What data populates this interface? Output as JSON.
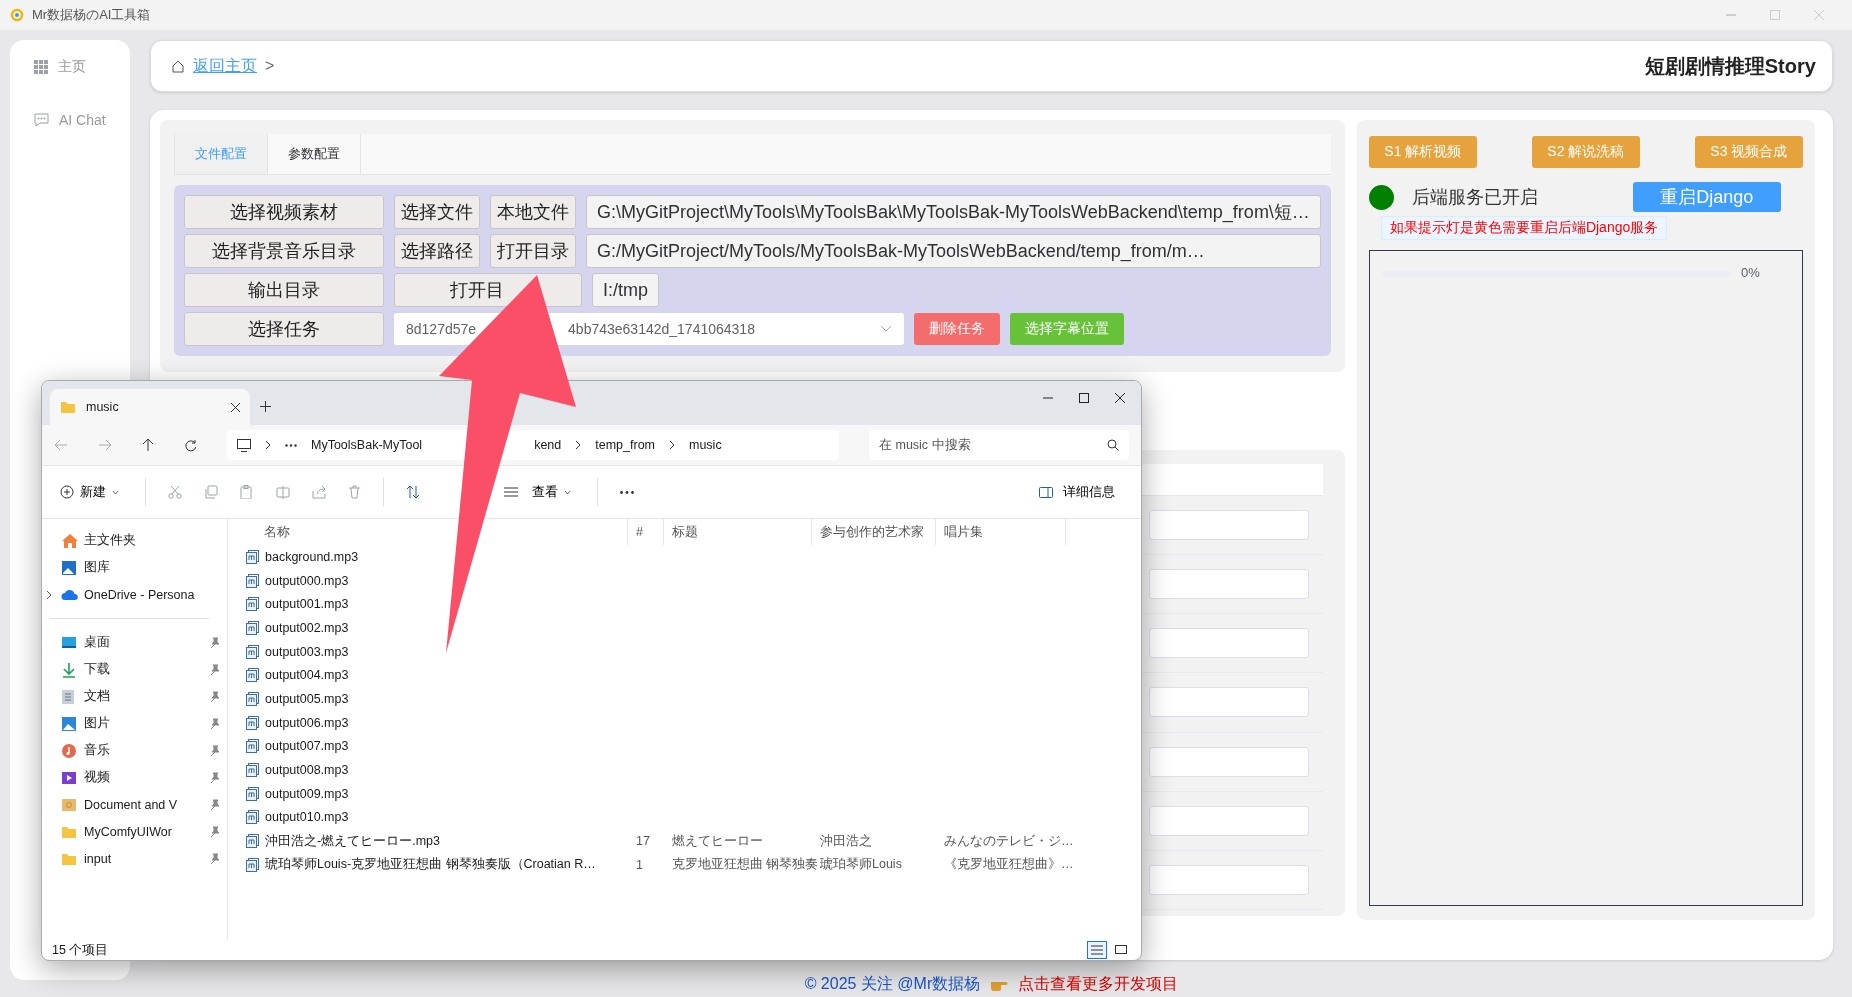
{
  "window": {
    "title": "Mr数据杨のAI工具箱"
  },
  "sidebar": {
    "items": [
      {
        "label": "主页",
        "kind": "grid"
      },
      {
        "label": "AI Chat",
        "kind": "chat"
      }
    ]
  },
  "header": {
    "breadcrumb_link": "返回主页",
    "breadcrumb_separator": ">",
    "title": "短剧剧情推理Story"
  },
  "config_tabs": [
    {
      "label": "文件配置",
      "selected": true
    },
    {
      "label": "参数配置",
      "selected": false
    }
  ],
  "file_rows": [
    {
      "label": "选择视频素材",
      "actions": [
        "选择文件",
        "本地文件"
      ],
      "path": "G:\\MyGitProject\\MyTools\\MyToolsBak\\MyToolsBak-MyToolsWebBackend\\temp_from\\短…"
    },
    {
      "label": "选择背景音乐目录",
      "actions": [
        "选择路径",
        "打开目录"
      ],
      "path": "G:/MyGitProject/MyTools/MyToolsBak-MyToolsWebBackend/temp_from/m…"
    },
    {
      "label": "输出目录",
      "actions": [
        "打开目"
      ],
      "path": "I:/tmp"
    }
  ],
  "task_row": {
    "label": "选择任务",
    "select_parts": [
      "8d127d57e",
      "4bb743e63142d_1741064318"
    ],
    "delete": "删除任务",
    "subtitle": "选择字幕位置"
  },
  "param_fields": [
    {
      "kind": "input"
    },
    {
      "kind": "input"
    },
    {
      "kind": "input"
    },
    {
      "kind": "input"
    },
    {
      "kind": "input"
    },
    {
      "kind": "input"
    },
    {
      "kind": "input"
    }
  ],
  "steps": [
    "S1 解析视频",
    "S2 解说洗稿",
    "S3 视频合成"
  ],
  "service": {
    "online": true,
    "label": "后端服务已开启",
    "restart": "重启Django",
    "note": "如果提示灯是黄色需要重启后端Django服务"
  },
  "progress": {
    "level": 0,
    "reading": "0%"
  },
  "footer": {
    "copyright": "© 2025 关注 @Mr数据杨",
    "link": "点击查看更多开发项目"
  },
  "explorer": {
    "tab_title": "music",
    "path_segments": [
      {
        "parts": [
          "MyToolsBak-MyTool",
          "kend"
        ]
      },
      {
        "parts": [
          "temp_from"
        ]
      },
      {
        "parts": [
          "music"
        ]
      }
    ],
    "search_placeholder": "在 music 中搜索",
    "new_label": "新建",
    "view_label": "查看",
    "details_label": "详细信息",
    "nav_groups": [
      [
        {
          "label": "主文件夹",
          "kind": "home",
          "pinned": false,
          "expandable": false
        },
        {
          "label": "图库",
          "kind": "gallery",
          "pinned": false,
          "expandable": false
        },
        {
          "label": "OneDrive - Persona",
          "kind": "cloud",
          "pinned": false,
          "expandable": true
        }
      ],
      [
        {
          "label": "桌面",
          "kind": "desktop",
          "pinned": true,
          "expandable": false
        },
        {
          "label": "下载",
          "kind": "download",
          "pinned": true,
          "expandable": false
        },
        {
          "label": "文档",
          "kind": "document",
          "pinned": true,
          "expandable": false
        },
        {
          "label": "图片",
          "kind": "pictures",
          "pinned": true,
          "expandable": false
        },
        {
          "label": "音乐",
          "kind": "music",
          "pinned": true,
          "expandable": false
        },
        {
          "label": "视频",
          "kind": "video",
          "pinned": true,
          "expandable": false
        },
        {
          "label": "Document and V",
          "kind": "shared",
          "pinned": true,
          "expandable": false
        },
        {
          "label": "MyComfyUIWor",
          "kind": "folder",
          "pinned": true,
          "expandable": false
        },
        {
          "label": "input",
          "kind": "folder",
          "pinned": true,
          "expandable": false
        }
      ]
    ],
    "columns": [
      "名称",
      "#",
      "标题",
      "参与创作的艺术家",
      "唱片集"
    ],
    "files": [
      {
        "name": "background.mp3"
      },
      {
        "name": "output000.mp3"
      },
      {
        "name": "output001.mp3"
      },
      {
        "name": "output002.mp3"
      },
      {
        "name": "output003.mp3"
      },
      {
        "name": "output004.mp3"
      },
      {
        "name": "output005.mp3"
      },
      {
        "name": "output006.mp3"
      },
      {
        "name": "output007.mp3"
      },
      {
        "name": "output008.mp3"
      },
      {
        "name": "output009.mp3"
      },
      {
        "name": "output010.mp3"
      },
      {
        "name": "沖田浩之-燃えてヒーロー.mp3",
        "number": "17",
        "title": "燃えてヒーロー",
        "artist": "沖田浩之",
        "album": "みんなのテレビ・ジ…"
      },
      {
        "name": "琥珀琴师Louis-克罗地亚狂想曲 钢琴独奏版（Croatian R…",
        "number": "1",
        "title": "克罗地亚狂想曲 钢琴独奏…",
        "artist": "琥珀琴师Louis",
        "album": "《克罗地亚狂想曲》…"
      }
    ],
    "status": "15 个项目",
    "view_modes": [
      {
        "kind": "details",
        "selected": true
      },
      {
        "kind": "tiles",
        "selected": false
      }
    ]
  }
}
